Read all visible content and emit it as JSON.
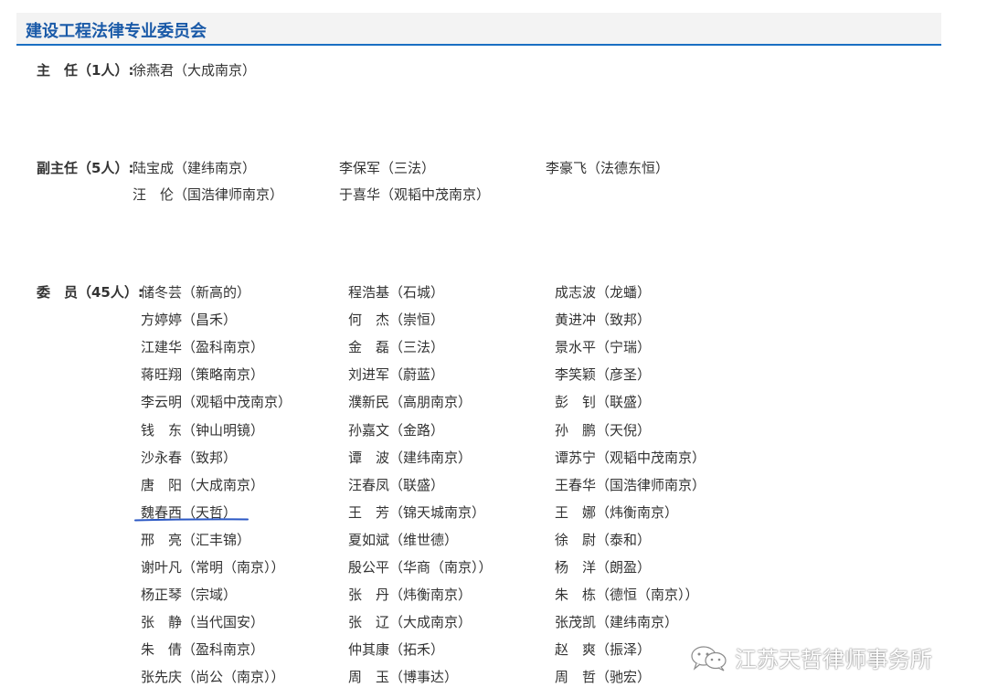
{
  "header": {
    "title": "建设工程法律专业委员会"
  },
  "director": {
    "label": "主　任（1人）:",
    "names": [
      "徐燕君（大成南京）"
    ]
  },
  "deputy": {
    "label": "副主任（5人）:",
    "names": [
      "陆宝成（建纬南京）",
      "李保军（三法）",
      "李豪飞（法德东恒）",
      "汪　伦（国浩律师南京）",
      "于喜华（观韬中茂南京）"
    ]
  },
  "members": {
    "label": "委　员（45人）:",
    "names": [
      "储冬芸（新高的）",
      "程浩基（石城）",
      "成志波（龙蟠）",
      "方婷婷（昌禾）",
      "何　杰（崇恒）",
      "黄进冲（致邦）",
      "江建华（盈科南京）",
      "金　磊（三法）",
      "景水平（宁瑞）",
      "蒋旺翔（策略南京）",
      "刘进军（蔚蓝）",
      "李笑颖（彦圣）",
      "李云明（观韬中茂南京）",
      "濮新民（高朋南京）",
      "彭　钊（联盛）",
      "钱　东（钟山明镜）",
      "孙嘉文（金路）",
      "孙　鹏（天倪）",
      "沙永春（致邦）",
      "谭　波（建纬南京）",
      "谭苏宁（观韬中茂南京）",
      "唐　阳（大成南京）",
      "汪春凤（联盛）",
      "王春华（国浩律师南京）",
      "魏春西（天哲）",
      "王　芳（锦天城南京）",
      "王　娜（炜衡南京）",
      "邢　亮（汇丰锦）",
      "夏如斌（维世德）",
      "徐　尉（泰和）",
      "谢叶凡（常明（南京））",
      "殷公平（华商（南京））",
      "杨　洋（朗盈）",
      "杨正琴（宗域）",
      "张　丹（炜衡南京）",
      "朱　栋（德恒（南京））",
      "张　静（当代国安）",
      "张　辽（大成南京）",
      "张茂凯（建纬南京）",
      "朱　倩（盈科南京）",
      "仲其康（拓禾）",
      "赵　爽（振泽）",
      "张先庆（尚公（南京））",
      "周　玉（博事达）",
      "周　哲（驰宏）"
    ]
  },
  "highlight": {
    "color": "#2a57c4"
  },
  "watermark": {
    "text": "江苏天哲律师事务所",
    "icon": "wechat-icon"
  },
  "colors": {
    "accent": "#1a6fc2",
    "title": "#1a5aa8",
    "text": "#333333",
    "header_bg": "#f3f3f3"
  }
}
